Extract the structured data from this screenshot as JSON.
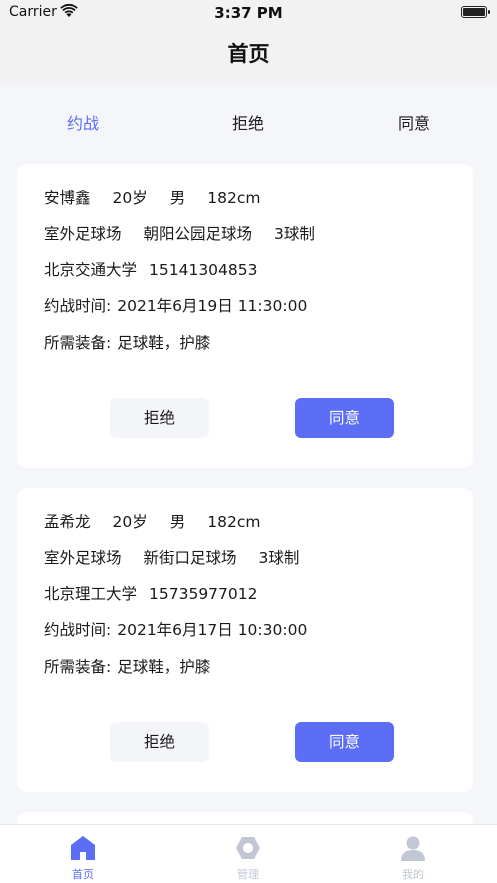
{
  "status_bar": {
    "carrier": "Carrier",
    "time": "3:37 PM"
  },
  "nav": {
    "title": "首页"
  },
  "tabs": [
    {
      "label": "约战",
      "active": true
    },
    {
      "label": "拒绝",
      "active": false
    },
    {
      "label": "同意",
      "active": false
    }
  ],
  "cards": [
    {
      "name": "安博鑫",
      "age": "20岁",
      "gender": "男",
      "height": "182cm",
      "field_type": "室外足球场",
      "venue": "朝阳公园足球场",
      "format": "3球制",
      "school": "北京交通大学",
      "phone": "15141304853",
      "time_label": "约战时间:",
      "time": "2021年6月19日 11:30:00",
      "gear_label": "所需装备:",
      "gear": "足球鞋，护膝",
      "reject_label": "拒绝",
      "agree_label": "同意"
    },
    {
      "name": "孟希龙",
      "age": "20岁",
      "gender": "男",
      "height": "182cm",
      "field_type": "室外足球场",
      "venue": "新街口足球场",
      "format": "3球制",
      "school": "北京理工大学",
      "phone": "15735977012",
      "time_label": "约战时间:",
      "time": "2021年6月17日 10:30:00",
      "gear_label": "所需装备:",
      "gear": "足球鞋，护膝",
      "reject_label": "拒绝",
      "agree_label": "同意"
    }
  ],
  "tab_bar": [
    {
      "label": "首页",
      "icon": "home-icon",
      "active": true
    },
    {
      "label": "管理",
      "icon": "manage-icon",
      "active": false
    },
    {
      "label": "我的",
      "icon": "profile-icon",
      "active": false
    }
  ],
  "colors": {
    "accent": "#5b6ef5",
    "inactive": "#c2c7d6",
    "background": "#f5f6fa"
  }
}
